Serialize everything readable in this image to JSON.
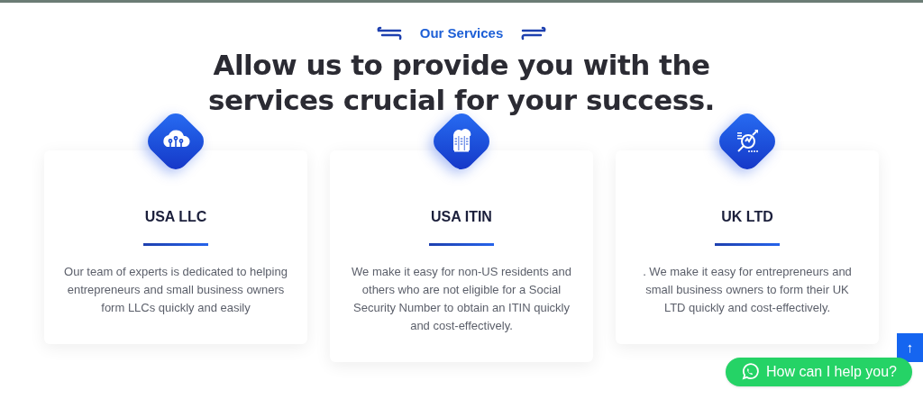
{
  "section_label": "Our Services",
  "heading": "Allow us to provide you with the services crucial for your success.",
  "services": [
    {
      "kind": "cloud",
      "title": "USA LLC",
      "description": "Our team of experts is dedicated to helping entrepreneurs and small business owners form LLCs quickly and easily"
    },
    {
      "kind": "servers",
      "title": "USA ITIN",
      "description": "We make it easy for non-US residents and others who are not eligible for a Social Security Number to obtain an ITIN quickly and cost-effectively."
    },
    {
      "kind": "analytics",
      "title": "UK LTD",
      "description": ". We make it easy for entrepreneurs and small business owners to form their UK LTD quickly and cost-effectively."
    }
  ],
  "scroll_top": "↑",
  "chat_button": "How can I help you?"
}
